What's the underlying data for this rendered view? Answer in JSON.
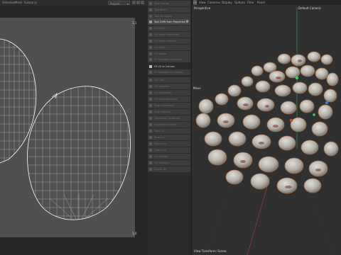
{
  "uv_editor": {
    "menu": [
      "Selection",
      "Mesh",
      "Subsurry"
    ],
    "project_select": "Project",
    "toolbar_icons": [
      "hand-icon",
      "zoom-icon",
      "frame-icon",
      "grid-icon",
      "settings-icon"
    ],
    "label_top": "1,1",
    "label_bottom": "1,0"
  },
  "tools": {
    "items": [
      {
        "label": "Tool Unwrap",
        "state": "dim"
      },
      {
        "label": "Tool Relax",
        "state": "dim"
      },
      {
        "label": "Tool Pin Edges",
        "state": "dim"
      },
      {
        "label": "Tool UVW from Projection",
        "state": "highlight",
        "gear": true
      },
      {
        "label": "UV Mirror",
        "state": "dim"
      },
      {
        "label": "UV Mirror Horizontal",
        "state": "dim"
      },
      {
        "label": "UV Mirror Vertical",
        "state": "dim"
      },
      {
        "label": "UV Scale",
        "state": "dim"
      },
      {
        "label": "UV Rotate",
        "state": "dim"
      },
      {
        "label": "Fit Selection to Region",
        "state": "dim"
      },
      {
        "label": "Fit Selection to Canvas",
        "state": "dim"
      }
    ],
    "section_header": "Fit UV to Canvas",
    "section_sub": "Fit Selection to Canvas",
    "items2": [
      {
        "label": "UV Grid",
        "state": "dim"
      },
      {
        "label": "UV Quantize",
        "state": "dim"
      },
      {
        "label": "UV Straighten",
        "state": "dim"
      },
      {
        "label": "UV Rectangularize",
        "state": "dim"
      },
      {
        "label": "Align Horizontal",
        "state": "dim"
      },
      {
        "label": "Align Vertical",
        "state": "dim"
      },
      {
        "label": "Distribute Horizontal",
        "state": "dim"
      },
      {
        "label": "Distribute Vertical",
        "state": "dim"
      },
      {
        "label": "Pack UV",
        "state": "dim"
      },
      {
        "label": "Stack UV",
        "state": "dim"
      },
      {
        "label": "Match UV",
        "state": "dim"
      },
      {
        "label": "Orient UV",
        "state": "dim"
      },
      {
        "label": "UV Checker",
        "state": "dim"
      },
      {
        "label": "UV Statistics",
        "state": "dim"
      },
      {
        "label": "Export UV",
        "state": "dim"
      },
      {
        "label": "Bake UV",
        "state": "dim"
      },
      {
        "label": "Reset UV",
        "state": "dim"
      }
    ]
  },
  "viewport": {
    "menu": [
      "View",
      "Cameras",
      "Display",
      "Options",
      "Filter",
      "Panel"
    ],
    "view_name": "Perspective",
    "camera_name": "Default Camera",
    "move_label": "Move",
    "footer_label": "View Transform: Scene"
  },
  "colors": {
    "accent": "#8a8a8a",
    "axis_x": "#d64141",
    "axis_y": "#3cd06a",
    "axis_z": "#3f7ad8",
    "stone": "#bdbab4",
    "stone_stain": "#7a2a22"
  }
}
